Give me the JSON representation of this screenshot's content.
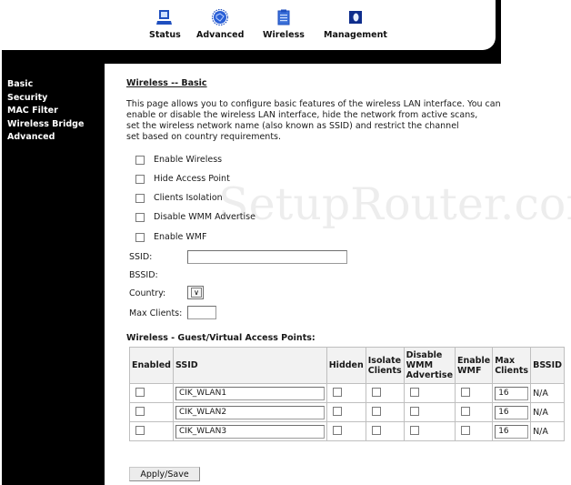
{
  "nav": {
    "items": [
      {
        "label": "Status",
        "icon": "monitor-icon"
      },
      {
        "label": "Advanced",
        "icon": "chip-icon"
      },
      {
        "label": "Wireless",
        "icon": "clipboard-icon"
      },
      {
        "label": "Management",
        "icon": "book-icon"
      }
    ]
  },
  "sidebar": {
    "items": [
      {
        "label": "Basic"
      },
      {
        "label": "Security"
      },
      {
        "label": "MAC Filter"
      },
      {
        "label": "Wireless Bridge"
      },
      {
        "label": "Advanced"
      }
    ]
  },
  "page": {
    "title": "Wireless -- Basic",
    "description": [
      "This page allows you to configure basic features of the wireless LAN interface. You can",
      "enable or disable the wireless LAN interface, hide the network from active scans,",
      "set the wireless network name (also known as SSID) and restrict the channel",
      "set based on country requirements."
    ]
  },
  "options": [
    {
      "label": "Enable Wireless",
      "checked": false
    },
    {
      "label": "Hide Access Point",
      "checked": false
    },
    {
      "label": "Clients Isolation",
      "checked": false
    },
    {
      "label": "Disable WMM Advertise",
      "checked": false
    },
    {
      "label": "Enable WMF",
      "checked": false
    }
  ],
  "form": {
    "ssid_label": "SSID:",
    "ssid_value": "",
    "bssid_label": "BSSID:",
    "bssid_value": "",
    "country_label": "Country:",
    "country_value": "",
    "max_clients_label": "Max Clients:",
    "max_clients_value": ""
  },
  "guest": {
    "title": "Wireless - Guest/Virtual Access Points:",
    "headers": {
      "enabled": "Enabled",
      "ssid": "SSID",
      "hidden": "Hidden",
      "isolate": [
        "Isolate",
        "Clients"
      ],
      "disable_wmm": [
        "Disable",
        "WMM",
        "Advertise"
      ],
      "enable_wmf": [
        "Enable",
        "WMF"
      ],
      "max_clients": [
        "Max",
        "Clients"
      ],
      "bssid": "BSSID"
    },
    "rows": [
      {
        "ssid": "CIK_WLAN1",
        "max_clients": "16",
        "bssid": "N/A"
      },
      {
        "ssid": "CIK_WLAN2",
        "max_clients": "16",
        "bssid": "N/A"
      },
      {
        "ssid": "CIK_WLAN3",
        "max_clients": "16",
        "bssid": "N/A"
      }
    ]
  },
  "actions": {
    "apply_label": "Apply/Save"
  },
  "watermark": "SetupRouter.com",
  "colors": {
    "frame": "#000000",
    "icon_blue": "#1f4fbf",
    "table_header_bg": "#f2f2f2"
  }
}
